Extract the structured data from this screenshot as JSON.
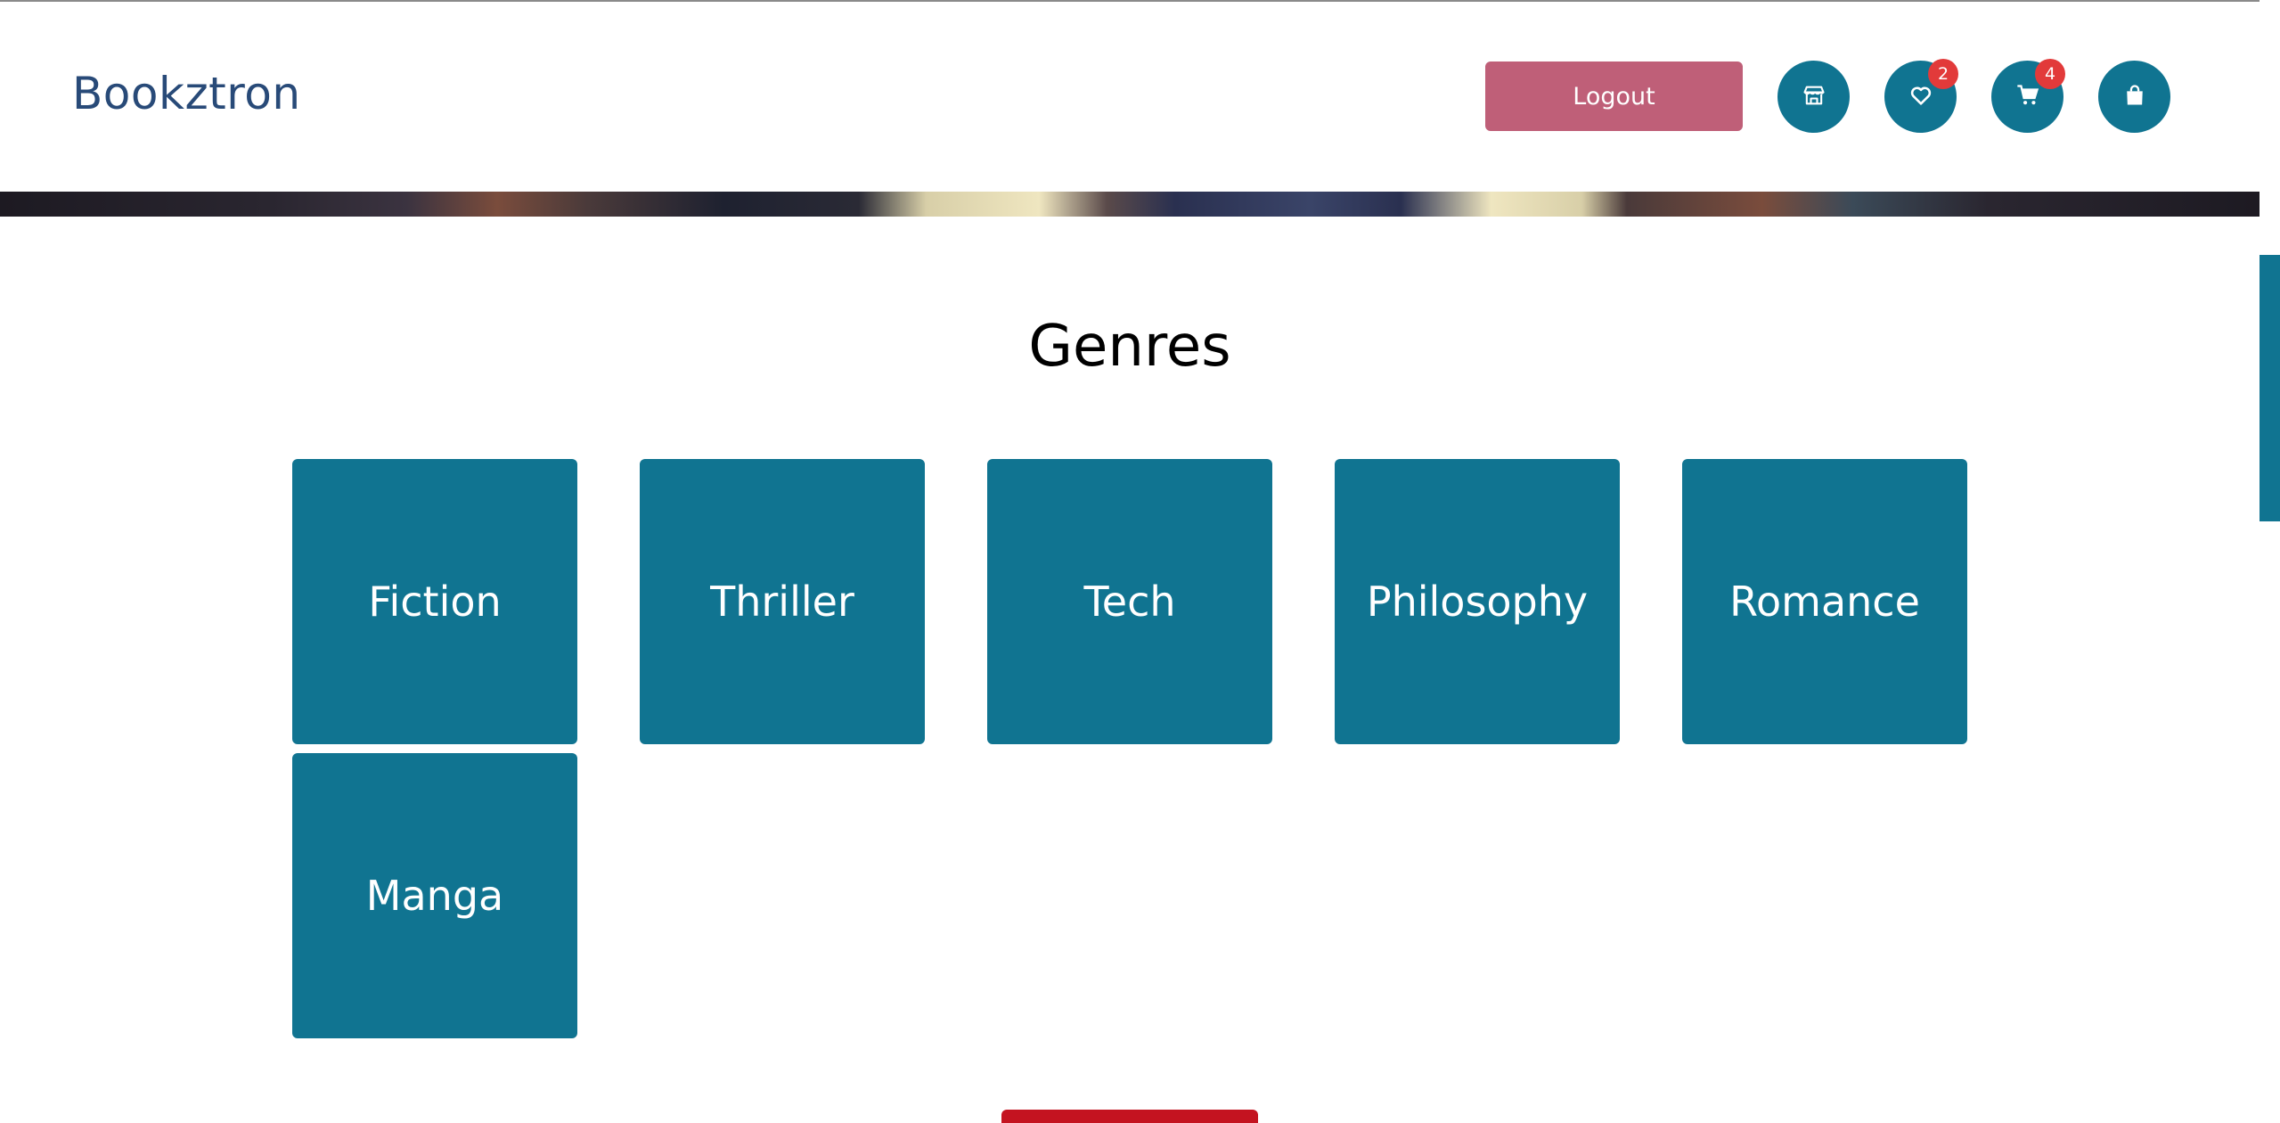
{
  "header": {
    "brand": "Bookztron",
    "logout_label": "Logout",
    "icons": [
      {
        "name": "store-icon"
      },
      {
        "name": "wishlist-icon",
        "badge": "2"
      },
      {
        "name": "cart-icon",
        "badge": "4"
      },
      {
        "name": "bag-icon"
      }
    ]
  },
  "genres": {
    "title": "Genres",
    "items": [
      "Fiction",
      "Thriller",
      "Tech",
      "Philosophy",
      "Romance",
      "Manga"
    ]
  },
  "colors": {
    "brand": "#284a78",
    "accent": "#107491",
    "logout": "#bf5f78",
    "badge": "#e23a3a",
    "cta": "#c41320"
  }
}
